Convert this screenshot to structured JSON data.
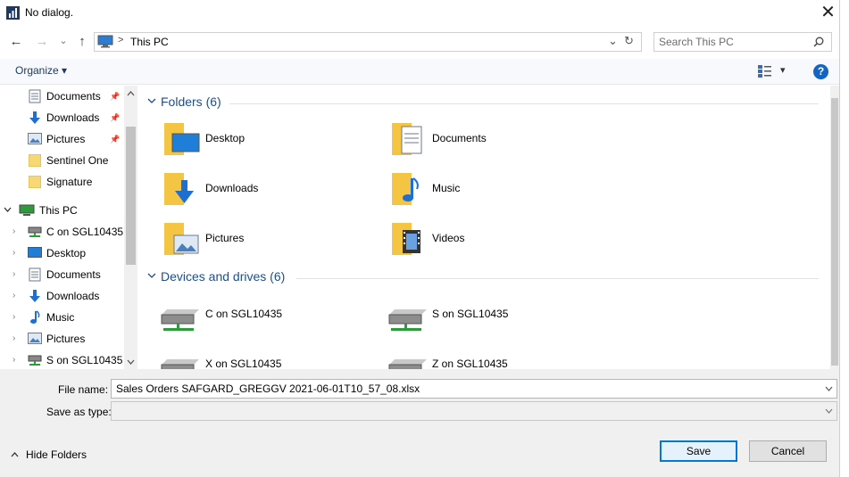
{
  "title": "No dialog.",
  "close_glyph": "✕",
  "nav": {
    "back": "←",
    "forward": "→",
    "recent": "⌄",
    "up": "↑",
    "breadcrumb_sep": ">",
    "refresh": "↻",
    "dropdown": "⌄"
  },
  "address": {
    "location": "This PC"
  },
  "search": {
    "placeholder": "Search This PC"
  },
  "toolbar": {
    "organize": "Organize",
    "organize_caret": "▾",
    "view_caret": "▾",
    "help": "?"
  },
  "nav_pane": {
    "quick": [
      {
        "label": "Documents",
        "icon": "documents-icon",
        "pin": "📌"
      },
      {
        "label": "Downloads",
        "icon": "downloads-icon",
        "pin": "📌"
      },
      {
        "label": "Pictures",
        "icon": "pictures-icon",
        "pin": "📌"
      },
      {
        "label": "Sentinel One",
        "icon": "folder-icon"
      },
      {
        "label": "Signature",
        "icon": "folder-icon"
      }
    ],
    "this_pc": "This PC",
    "pc_items": [
      {
        "label": "C on SGL10435",
        "icon": "network-drive-icon"
      },
      {
        "label": "Desktop",
        "icon": "desktop-icon"
      },
      {
        "label": "Documents",
        "icon": "documents-icon"
      },
      {
        "label": "Downloads",
        "icon": "downloads-icon"
      },
      {
        "label": "Music",
        "icon": "music-icon"
      },
      {
        "label": "Pictures",
        "icon": "pictures-icon"
      },
      {
        "label": "S on SGL10435",
        "icon": "network-drive-icon"
      }
    ]
  },
  "content": {
    "folders_header": "Folders (6)",
    "folders": [
      "Desktop",
      "Documents",
      "Downloads",
      "Music",
      "Pictures",
      "Videos"
    ],
    "drives_header": "Devices and drives (6)",
    "drives": [
      "C on SGL10435",
      "S on SGL10435",
      "X on SGL10435",
      "Z on SGL10435"
    ]
  },
  "form": {
    "file_name_label": "File name:",
    "file_name_value": "Sales Orders SAFGARD_GREGGV 2021-06-01T10_57_08.xlsx",
    "save_as_type_label": "Save as type:",
    "save_as_type_value": ""
  },
  "buttons": {
    "hide_folders": "Hide Folders",
    "save": "Save",
    "cancel": "Cancel"
  },
  "colors": {
    "accent": "#0078d7",
    "highlight": "#e6ff1a",
    "folder": "#f4c542"
  }
}
